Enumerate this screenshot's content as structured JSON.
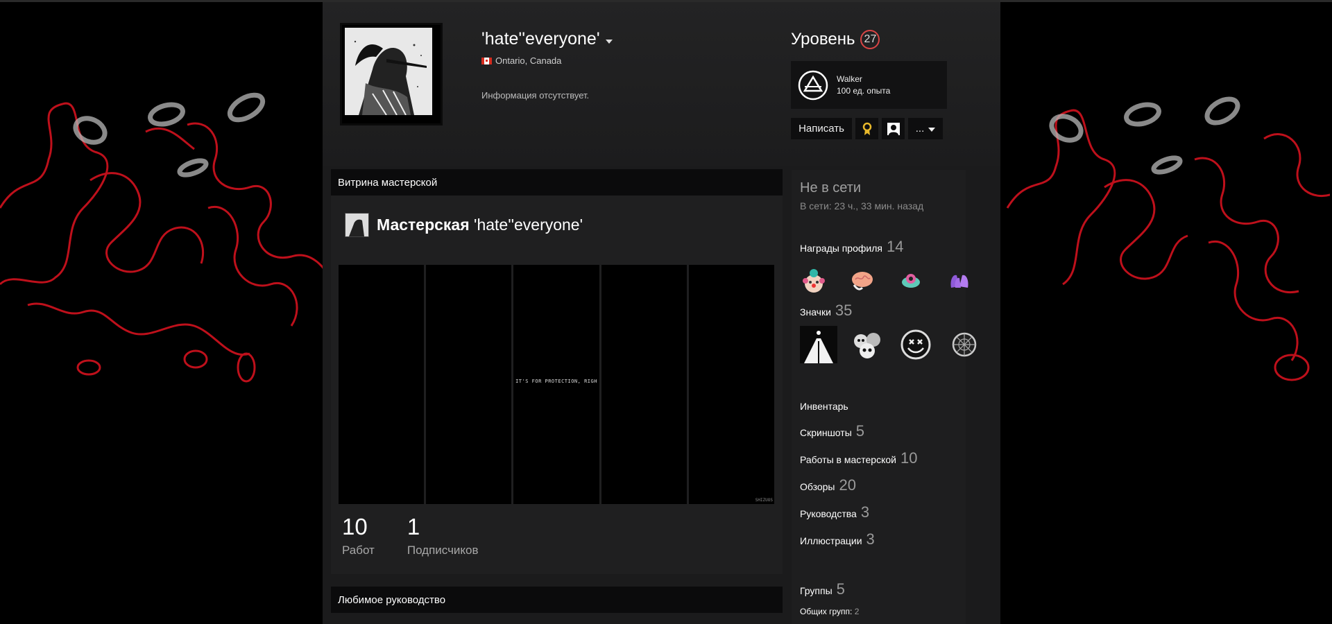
{
  "profile": {
    "persona_name": "'hate''everyone'",
    "location": "Ontario, Canada",
    "summary": "Информация отсутствует."
  },
  "level": {
    "label": "Уровень",
    "value": "27",
    "badge_name": "Walker",
    "badge_xp": "100 ед. опыта"
  },
  "actions": {
    "write_label": "Написать",
    "more_label": "..."
  },
  "workshop_showcase": {
    "title": "Витрина мастерской",
    "heading_bold": "Мастерская",
    "heading_name": "'hate''everyone'",
    "image_caption": "IT'S FOR PROTECTION, RIGH",
    "watermark": "SHIZUOS",
    "stats": [
      {
        "value": "10",
        "label": "Работ"
      },
      {
        "value": "1",
        "label": "Подписчиков"
      }
    ]
  },
  "favorite_guide": {
    "title": "Любимое руководство"
  },
  "sidebar": {
    "status": "Не в сети",
    "last_online": "В сети: 23 ч., 33 мин. назад",
    "awards": {
      "label": "Награды профиля",
      "count": "14"
    },
    "badges": {
      "label": "Значки",
      "count": "35"
    },
    "links": [
      {
        "label": "Инвентарь",
        "count": ""
      },
      {
        "label": "Скриншоты",
        "count": "5"
      },
      {
        "label": "Работы в мастерской",
        "count": "10"
      },
      {
        "label": "Обзоры",
        "count": "20"
      },
      {
        "label": "Руководства",
        "count": "3"
      },
      {
        "label": "Иллюстрации",
        "count": "3"
      }
    ],
    "groups": {
      "label": "Группы",
      "count": "5",
      "common_label": "Общих групп:",
      "common_count": "2"
    }
  },
  "colors": {
    "page_bg": "#1b1b1c",
    "level_ring": "#d94545",
    "bg_accent": "#d3121f"
  }
}
